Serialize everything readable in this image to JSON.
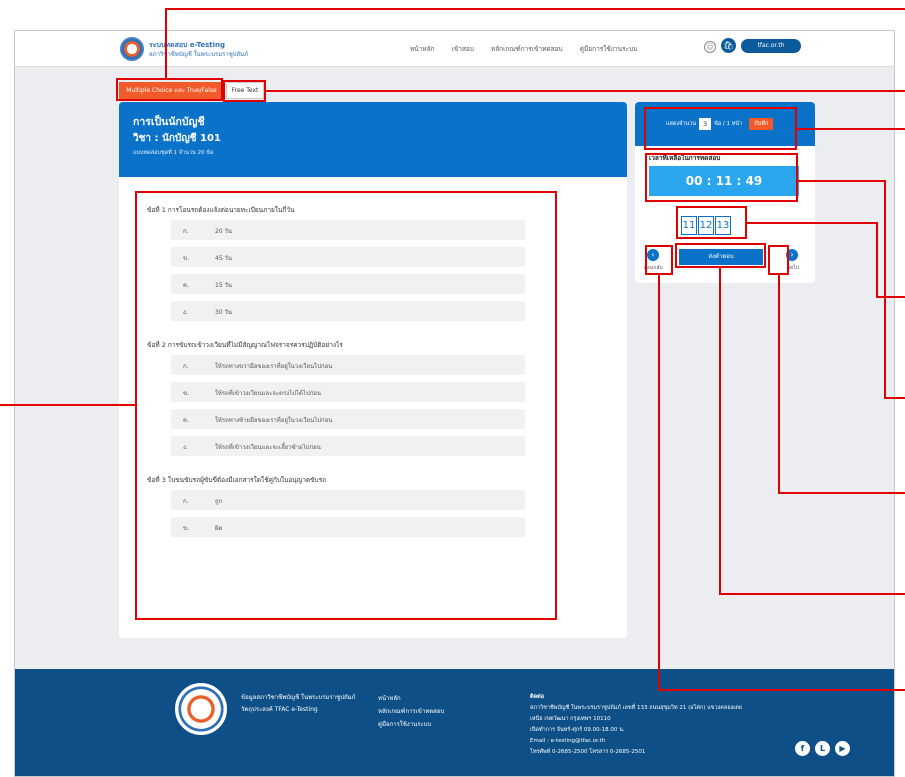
{
  "header": {
    "brand_line1": "ระบบทดสอบ e-Testing",
    "brand_line2": "สภาวิชาชีพบัญชี ในพระบรมราชูปถัมภ์",
    "nav": [
      "หน้าหลัก",
      "เข้าสอบ",
      "หลักเกณฑ์การเข้าทดสอบ",
      "คู่มือการใช้งานระบบ"
    ],
    "site_button": "tfac.or.th",
    "icons": [
      "user-icon",
      "bag-icon"
    ]
  },
  "tabs": {
    "multiple_choice": "Multiple Choice และ True/False",
    "free_text": "Free Text"
  },
  "exam": {
    "title": "การเป็นนักบัญชี",
    "subject": "วิชา : นักบัญชี 101",
    "note": "แบบทดสอบชุดที่ 1 จำนวน 20 ข้อ",
    "questions": [
      {
        "text": "ข้อที่ 1 การโอนรถต้องแจ้งต่อนายทะเบียนภายในกี่วัน",
        "options": [
          {
            "key": "ก.",
            "text": "20 วัน"
          },
          {
            "key": "ข.",
            "text": "45 วัน"
          },
          {
            "key": "ค.",
            "text": "15 วัน"
          },
          {
            "key": "ง.",
            "text": "30 วัน"
          }
        ]
      },
      {
        "text": "ข้อที่ 2 การขับรถเข้าวงเวียนที่ไม่มีสัญญาณไฟจราจรควรปฏิบัติอย่างไร",
        "options": [
          {
            "key": "ก.",
            "text": "ให้รถทางขวามือของเราที่อยู่ในวงเวียนไปก่อน"
          },
          {
            "key": "ข.",
            "text": "ให้รถที่เข้าวงเวียนและจะตรงไปได้ไปก่อน"
          },
          {
            "key": "ค.",
            "text": "ให้รถทางซ้ายมือของเราที่อยู่ในวงเวียนไปก่อน"
          },
          {
            "key": "ง.",
            "text": "ให้รถที่เข้าวงเวียนและจะเลี้ยวซ้ายไปก่อน"
          }
        ]
      },
      {
        "text": "ข้อที่ 3 ใบขนขับรถผู้ขับขี่ต้องมีเอกสารใดใช้คู่กับใบอนุญาตขับรถ",
        "options": [
          {
            "key": "ก.",
            "text": "ถูก"
          },
          {
            "key": "ข.",
            "text": "ผิด"
          }
        ]
      }
    ]
  },
  "sidebar": {
    "per_page_prefix": "แสดงจำนวน",
    "per_page_value": "3",
    "per_page_suffix": "ข้อ / 1 หน้า",
    "per_page_save": "บันทึก",
    "timer_label": "เวลาที่เหลือในการทดสอบ",
    "timer": "00 : 11 : 49",
    "pages": [
      "11",
      "12",
      "13"
    ],
    "prev_label": "ย้อนกลับ",
    "next_label": "ถัดไป",
    "submit": "ส่งคำตอบ"
  },
  "footer": {
    "col1": [
      "ข้อมูลสภาวิชาชีพบัญชี ในพระบรมราชูปถัมภ์",
      "วัตถุประสงค์ TFAC e-Testing"
    ],
    "col2": [
      "หน้าหลัก",
      "หลักเกณฑ์การเข้าทดสอบ",
      "คู่มือการใช้งานระบบ"
    ],
    "contact_title": "ติดต่อ",
    "contact": [
      "สภาวิชาชีพบัญชี ในพระบรมราชูปถัมภ์ เลขที่ 133 ถนนสุขุมวิท 21 (อโศก) แขวงคลองเตย",
      "เหนือ เขตวัฒนา กรุงเทพฯ 10110",
      "เปิดทำการ จันทร์-ศุกร์ 09.00-18.00 น.",
      "Email : e-testing@tfac.or.th",
      "โทรศัพท์ 0-2685-2500 โทรสาร 0-2685-2501"
    ],
    "social_icons": [
      "facebook-icon",
      "line-icon",
      "youtube-icon"
    ],
    "social_glyphs": [
      "f",
      "L",
      "▶"
    ]
  },
  "glyphs": {
    "user": "☺",
    "bag": "🛍",
    "prev": "‹",
    "next": "›"
  },
  "colors": {
    "primary": "#0a72c9",
    "accent": "#f15a29",
    "timer": "#2aa6ef",
    "footer": "#0d4f86",
    "annotation": "#e00000"
  }
}
